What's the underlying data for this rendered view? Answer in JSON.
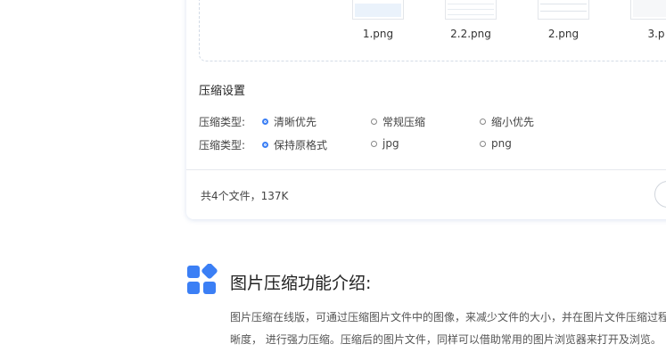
{
  "files": [
    {
      "name": "1.png"
    },
    {
      "name": "2.2.png"
    },
    {
      "name": "2.png"
    },
    {
      "name": "3.p"
    }
  ],
  "settings": {
    "title": "压缩设置",
    "rows": [
      {
        "label": "压缩类型:",
        "options": [
          "清晰优先",
          "常规压缩",
          "缩小优先"
        ],
        "selected": 0
      },
      {
        "label": "压缩类型:",
        "options": [
          "保持原格式",
          "jpg",
          "png"
        ],
        "selected": 0
      }
    ]
  },
  "summary": "共4个文件，137K",
  "intro": {
    "title": "图片压缩功能介绍:",
    "line1": "图片压缩在线版，可通过压缩图片文件中的图像，来减少文件的大小，并在图片文件压缩过程",
    "line2": "晰度， 进行强力压缩。压缩后的图片文件，同样可以借助常用的图片浏览器来打开及浏览。"
  },
  "colors": {
    "accent": "#3b7ff5"
  }
}
